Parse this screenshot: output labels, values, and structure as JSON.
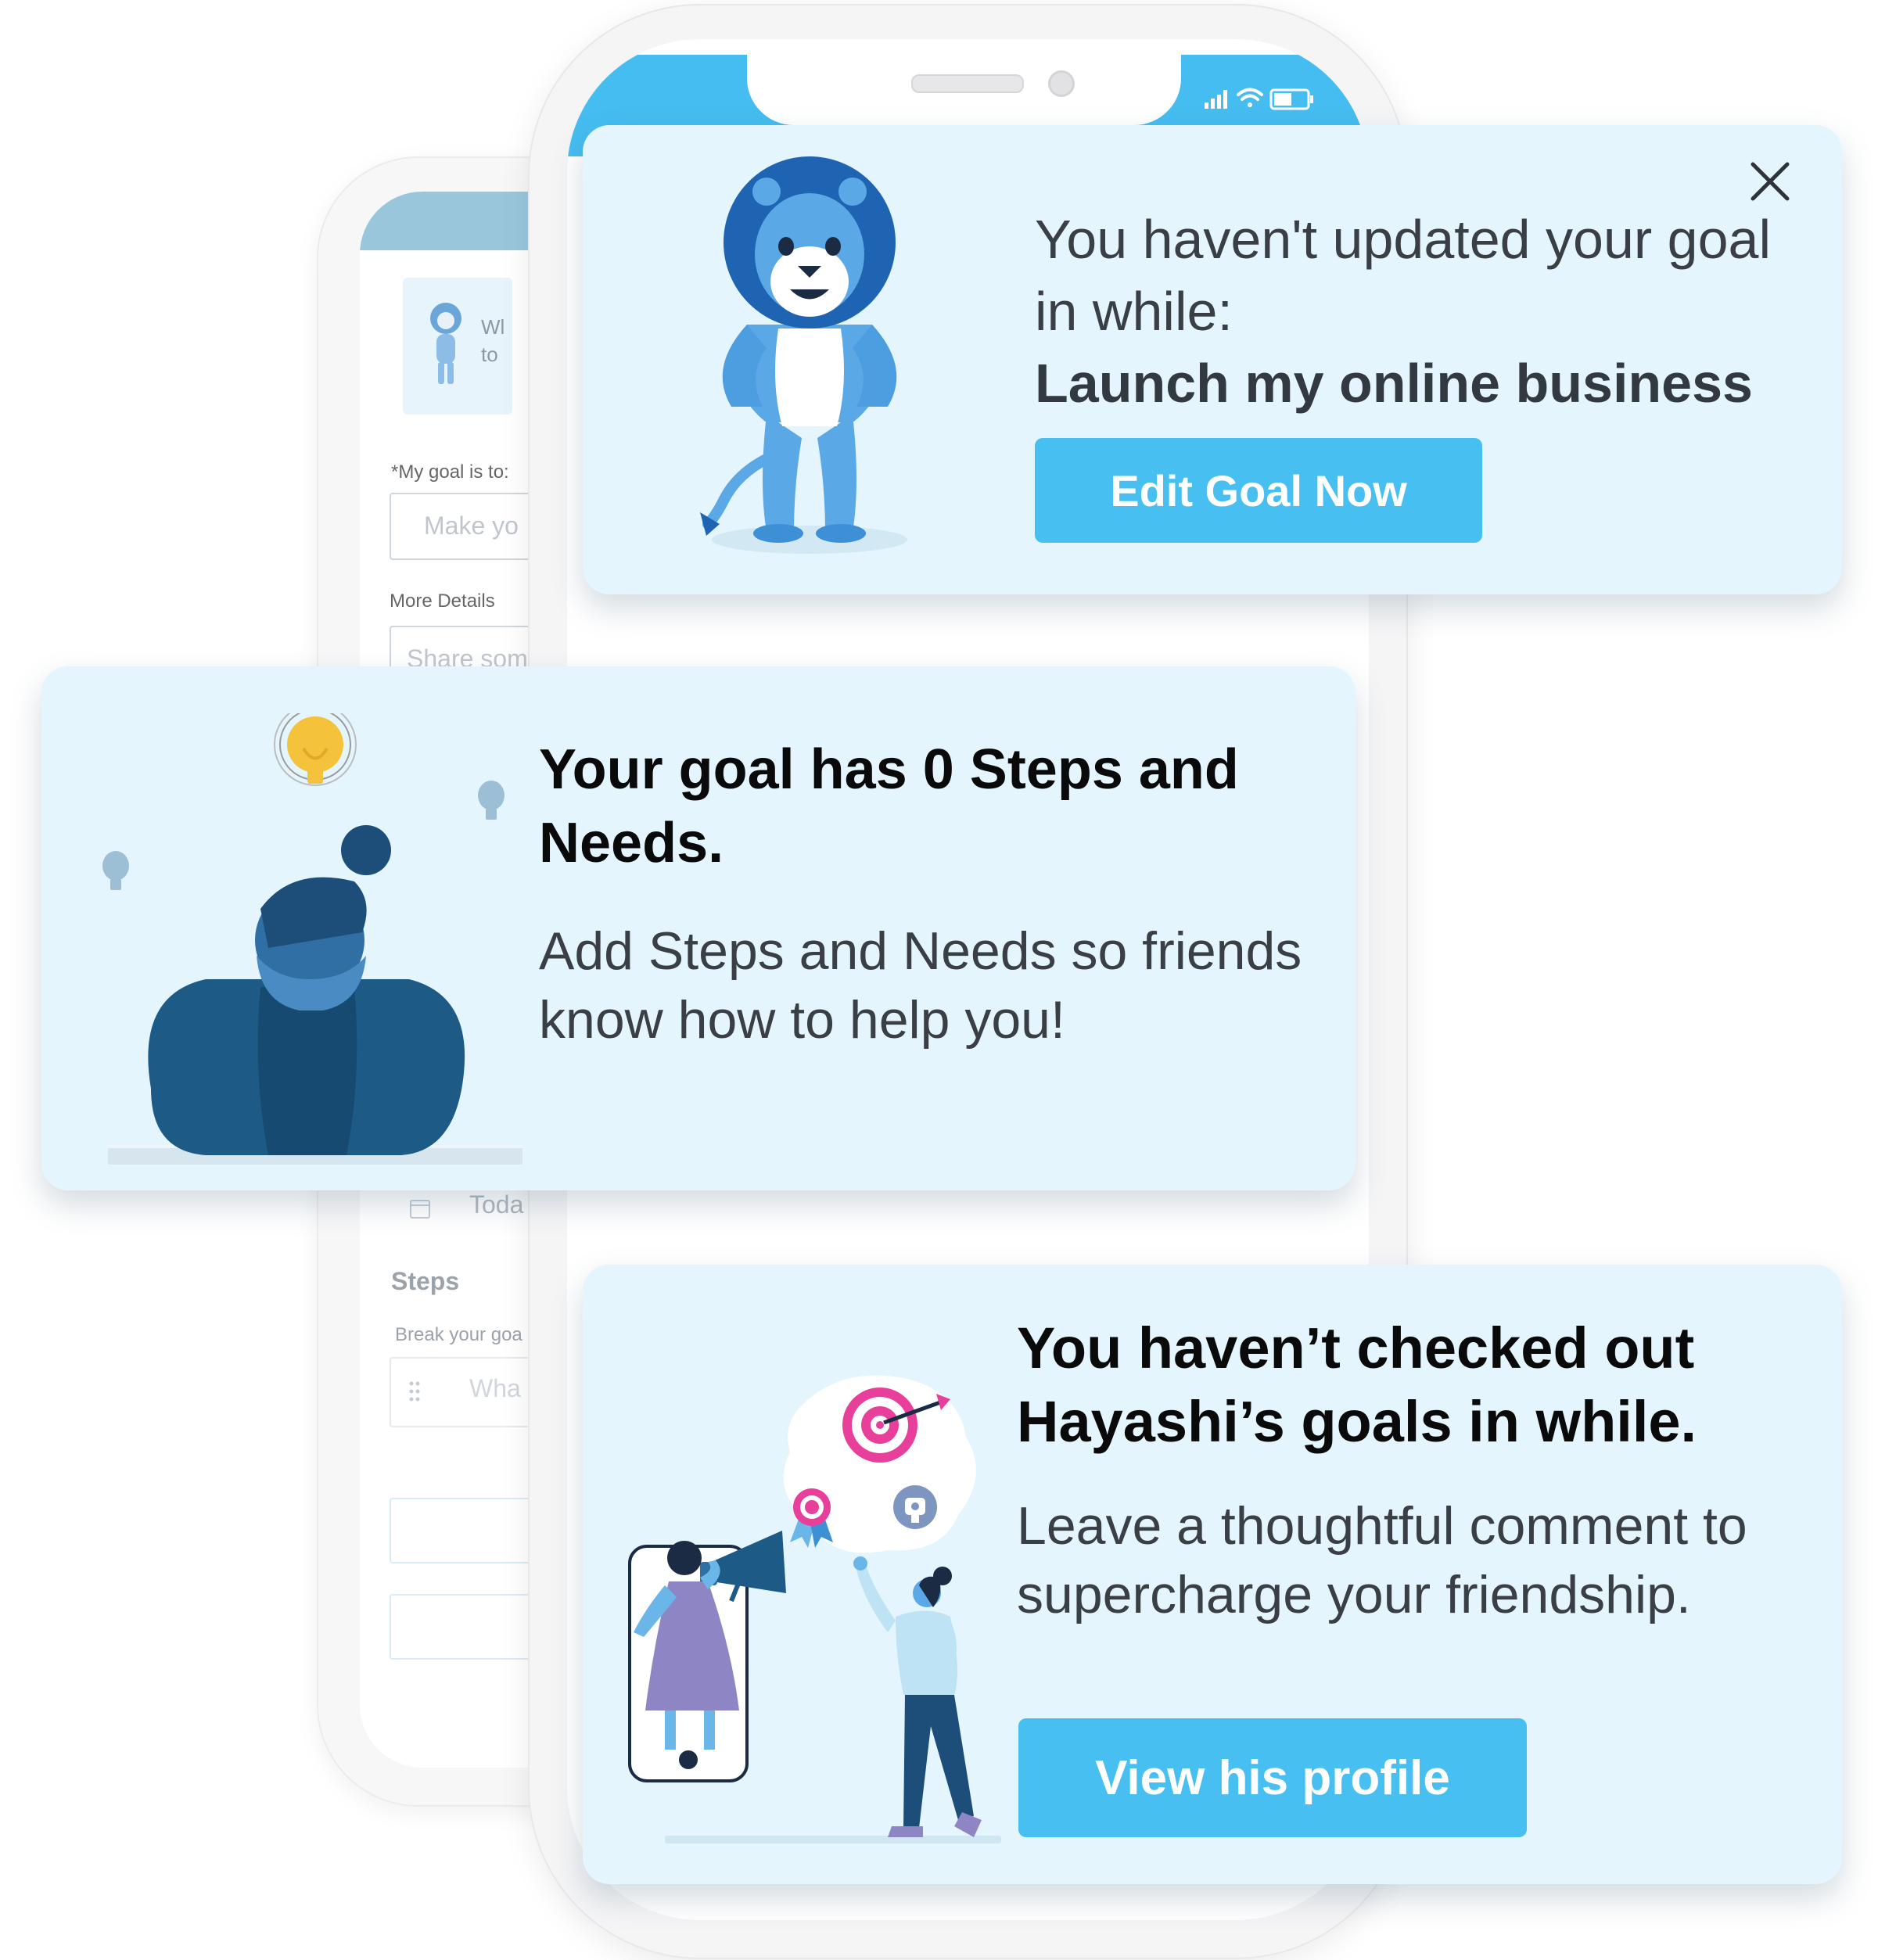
{
  "back_screen": {
    "card_text_line1": "Wl",
    "card_text_line2": "to",
    "goal_label": "*My goal is to:",
    "goal_placeholder": "Make yo",
    "details_label": "More Details",
    "details_placeholder": "Share som",
    "date_value": "Toda",
    "steps_heading": "Steps",
    "steps_hint": "Break your goa",
    "step_placeholder": "Wha"
  },
  "card1": {
    "message_line1": "You haven't updated your goal in while:",
    "goal_name": "Launch my online business",
    "button_label": "Edit Goal Now"
  },
  "card2": {
    "title": "Your goal has 0 Steps and Needs.",
    "body": "Add Steps and Needs so friends know how to help you!"
  },
  "card3": {
    "title": "You haven’t checked out Hayashi’s goals in while.",
    "body": "Leave a thoughtful comment to supercharge your friendship.",
    "button_label": "View his profile"
  },
  "icons": [
    "close-icon",
    "signal-icon",
    "wifi-icon",
    "battery-icon",
    "lion-mascot",
    "lightbulb-icon",
    "target-icon",
    "megaphone-icon",
    "award-ribbon-icon",
    "trophy-icon",
    "calendar-icon",
    "drag-handle-icon"
  ],
  "colors": {
    "accent": "#47bff0",
    "card_bg": "#e4f5fd",
    "status_bar": "#45bdf0",
    "lion_dark": "#1f64b3",
    "lion_light": "#5aa8e6",
    "bulb": "#f5c33b",
    "target": "#e8409a",
    "dress": "#8e86c4"
  }
}
